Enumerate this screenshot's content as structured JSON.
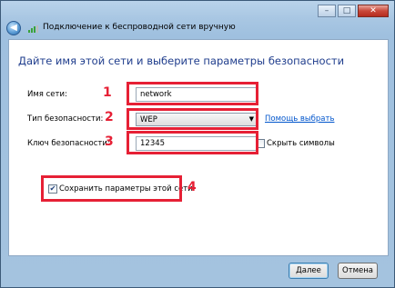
{
  "window": {
    "title": "Подключение к беспроводной сети вручную",
    "back_icon": "arrow-left-icon",
    "minimize_glyph": "–",
    "maximize_glyph": "□",
    "close_glyph": "✕"
  },
  "main": {
    "heading": "Дайте имя этой сети и выберите параметры безопасности",
    "network_name_label": "Имя сети:",
    "network_name_value": "network",
    "security_type_label": "Тип безопасности:",
    "security_type_value": "WEP",
    "help_link": "Помощь выбрать",
    "security_key_label": "Ключ безопасности:",
    "security_key_value": "12345",
    "hide_chars_label": "Скрыть символы",
    "hide_chars_checked": false,
    "save_settings_label": "Сохранить параметры этой сети",
    "save_settings_checked": true
  },
  "annotations": {
    "n1": "1",
    "n2": "2",
    "n3": "3",
    "n4": "4",
    "color": "#e62035"
  },
  "footer": {
    "next_label": "Далее",
    "cancel_label": "Отмена"
  }
}
